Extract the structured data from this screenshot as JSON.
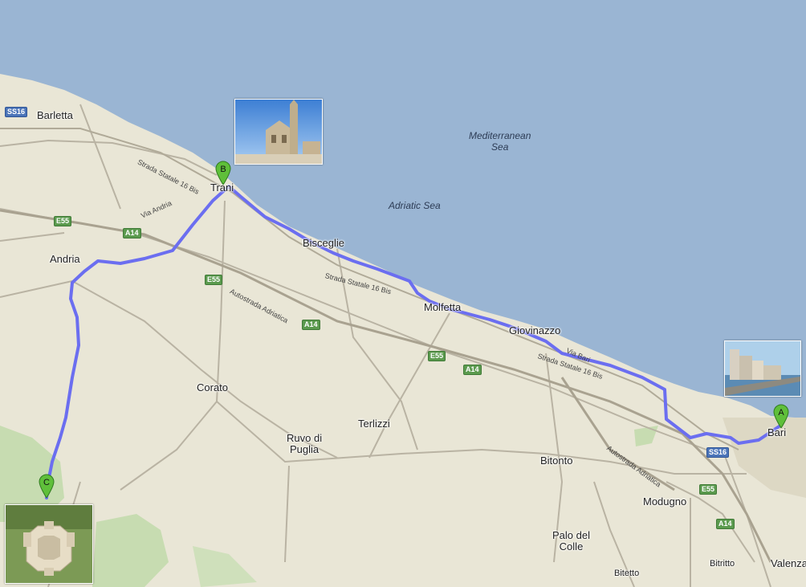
{
  "map": {
    "sea_labels": {
      "mediterranean_line1": "Mediterranean",
      "mediterranean_line2": "Sea",
      "adriatic": "Adriatic Sea"
    },
    "places": {
      "barletta": "Barletta",
      "trani": "Trani",
      "andria": "Andria",
      "bisceglie": "Bisceglie",
      "molfetta": "Molfetta",
      "giovinazzo": "Giovinazzo",
      "bari": "Bari",
      "corato": "Corato",
      "terlizzi": "Terlizzi",
      "ruvo_line1": "Ruvo di",
      "ruvo_line2": "Puglia",
      "bitonto": "Bitonto",
      "modugno": "Modugno",
      "palo_line1": "Palo del",
      "palo_line2": "Colle",
      "bitritto": "Bitritto",
      "bitetto": "Bitetto",
      "valenzano": "Valenza"
    },
    "roads": {
      "ss16bis_1": "Strada Statale 16 Bis",
      "ss16bis_2": "Strada Statale 16 Bis",
      "ss16bis_3": "Strada Statale 16 Bis",
      "via_andria": "Via Andria",
      "via_bari": "Via Bari",
      "autostrada_1": "Autostrada Adriatica",
      "autostrada_2": "Autostrada Adriatica"
    },
    "shields": {
      "ss16_a": "SS16",
      "ss16_b": "SS16",
      "e55_a": "E55",
      "e55_b": "E55",
      "e55_c": "E55",
      "e55_d": "E55",
      "a14_a": "A14",
      "a14_b": "A14",
      "a14_c": "A14",
      "a14_d": "A14"
    },
    "markers": {
      "a": "A",
      "b": "B",
      "c": "C"
    },
    "colors": {
      "sea": "#9ab5d3",
      "land": "#e9e6d6",
      "route": "#6b6ef0",
      "marker": "#5fbf3a",
      "forest": "#bfd8a8"
    }
  }
}
